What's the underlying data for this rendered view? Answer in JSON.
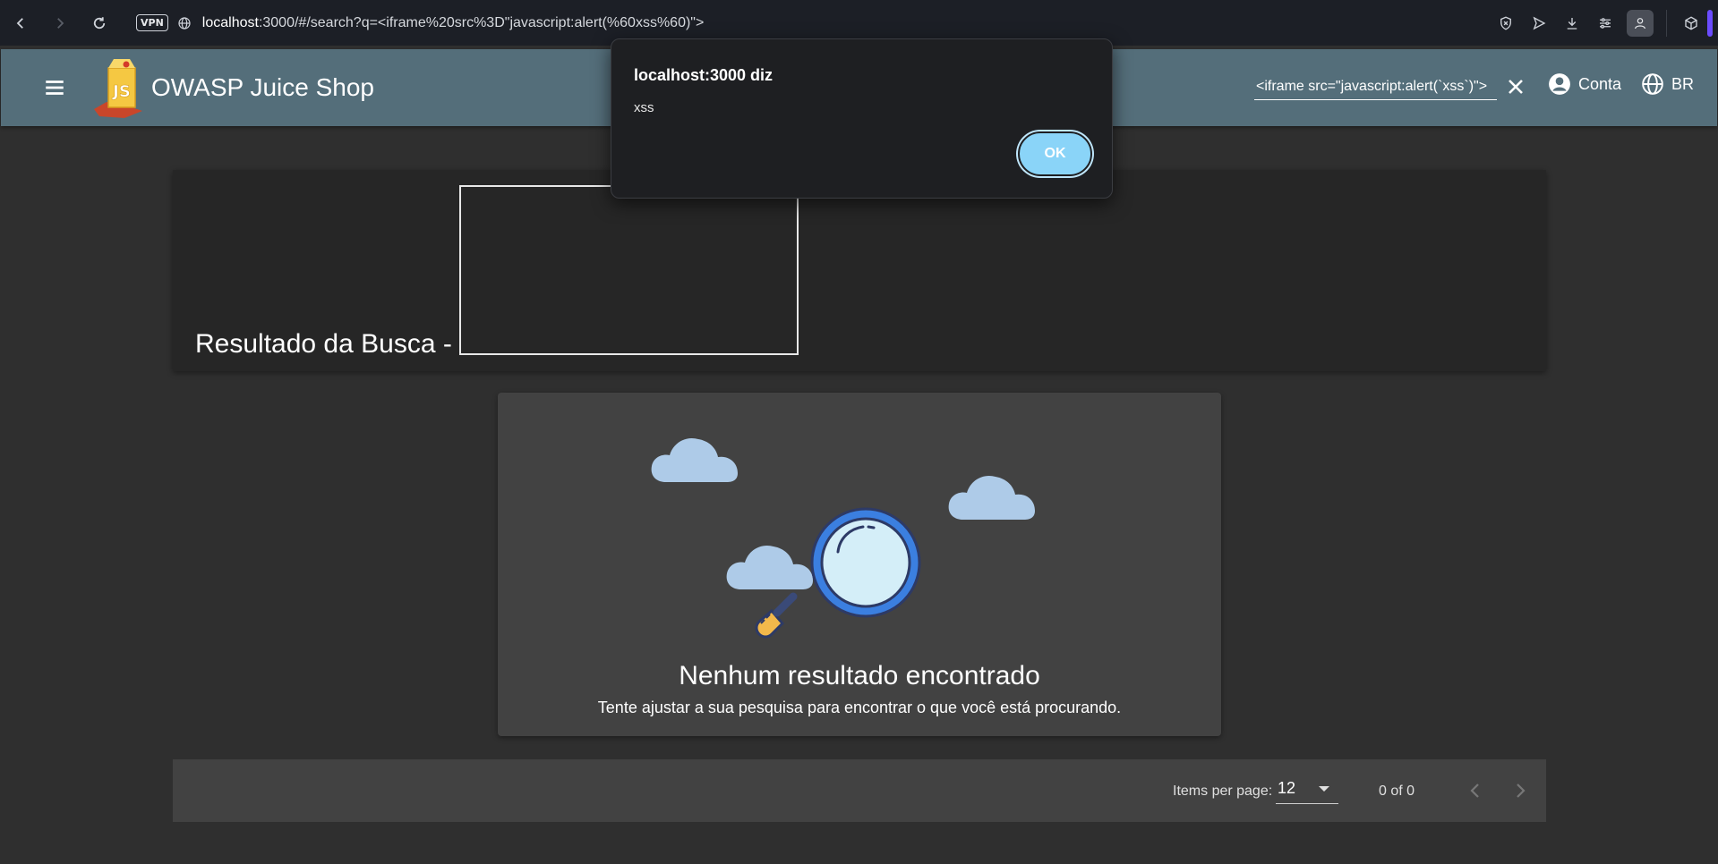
{
  "browser": {
    "url_host": "localhost",
    "url_rest": ":3000/#/search?q=<iframe%20src%3D\"javascript:alert(%60xss%60)\">",
    "vpn_label": "VPN"
  },
  "app": {
    "title": "OWASP Juice Shop",
    "logo_text": "JS",
    "search_value": "<iframe src=\"javascript:alert(`xss`)\">",
    "account_label": "Conta",
    "language_label": "BR"
  },
  "results": {
    "title": "Resultado da Busca -"
  },
  "no_results": {
    "title": "Nenhum resultado encontrado",
    "subtitle": "Tente ajustar a sua pesquisa para encontrar o que você está procurando."
  },
  "paginator": {
    "items_per_page_label": "Items per page:",
    "items_per_page_value": "12",
    "range_label": "0 of 0"
  },
  "alert": {
    "title": "localhost:3000 diz",
    "message": "xss",
    "ok_label": "OK"
  },
  "colors": {
    "toolbar": "#546e7a",
    "background": "#2f2f2f",
    "ok_button": "#8ad4f8"
  }
}
